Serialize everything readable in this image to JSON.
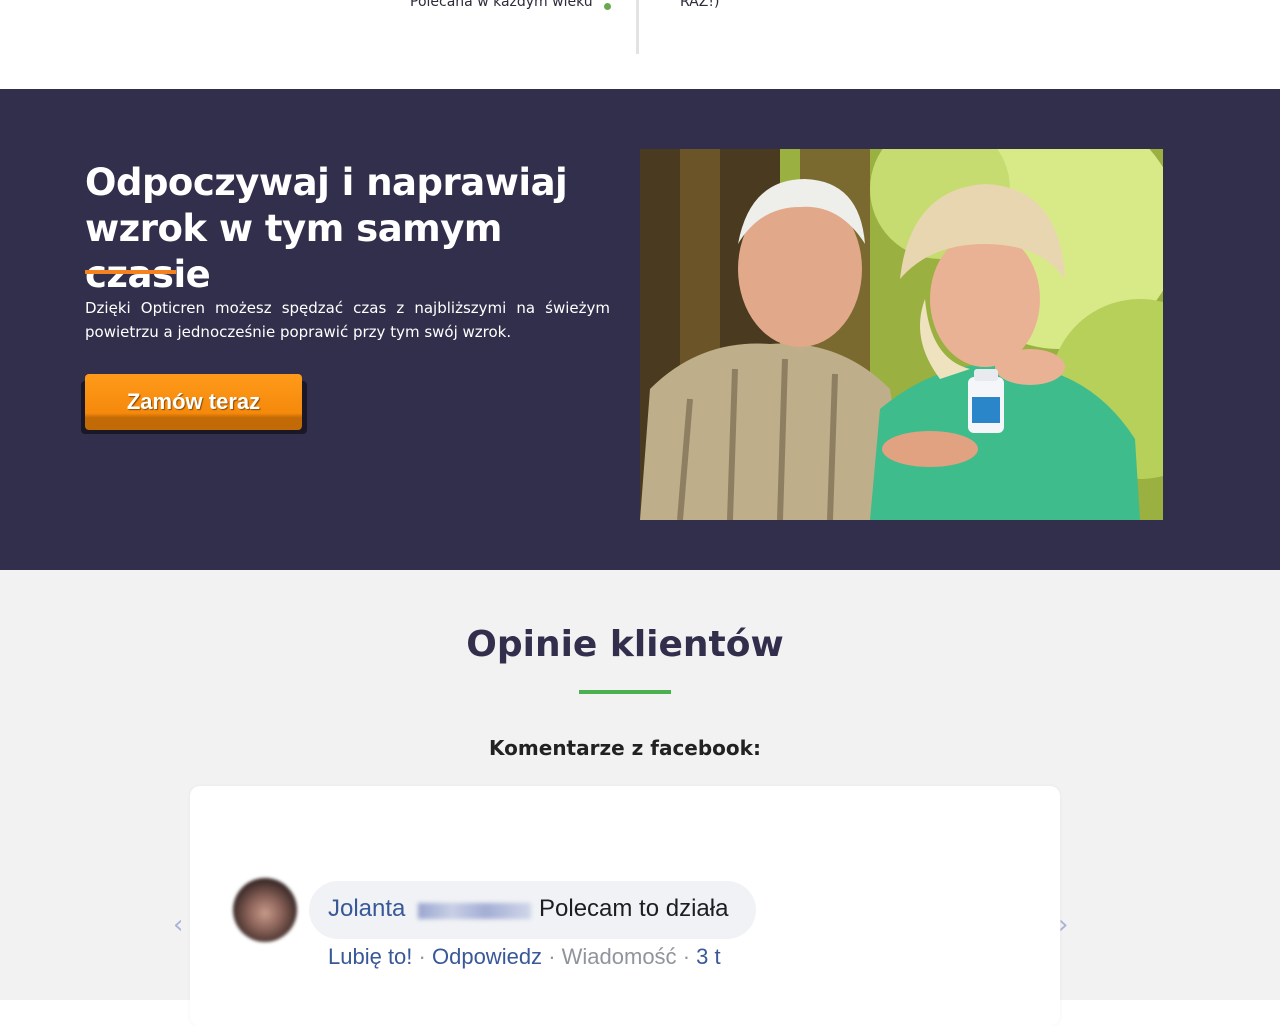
{
  "top": {
    "left_text": "Polecana w każdym wieku",
    "right_text": "RAZ!)"
  },
  "hero": {
    "title": "Odpoczywaj i naprawiaj wzrok w tym samym czasie",
    "description": "Dzięki Opticren możesz spędzać czas z najbliższymi na świeżym powietrzu a jednocześnie poprawić przy tym swój wzrok.",
    "order_button": "Zamów teraz",
    "accent_color": "#f58220",
    "background_color": "#312f4b"
  },
  "reviews": {
    "title": "Opinie klientów",
    "underline_color": "#4cb050",
    "facebook_heading": "Komentarze z facebook:",
    "comment": {
      "author": "Jolanta",
      "text": "Polecam to działa",
      "like": "Lubię to!",
      "reply": "Odpowiedz",
      "message": "Wiadomość",
      "time": "3 t",
      "separator": "·"
    },
    "prev_arrow": "‹",
    "next_arrow": "›"
  }
}
